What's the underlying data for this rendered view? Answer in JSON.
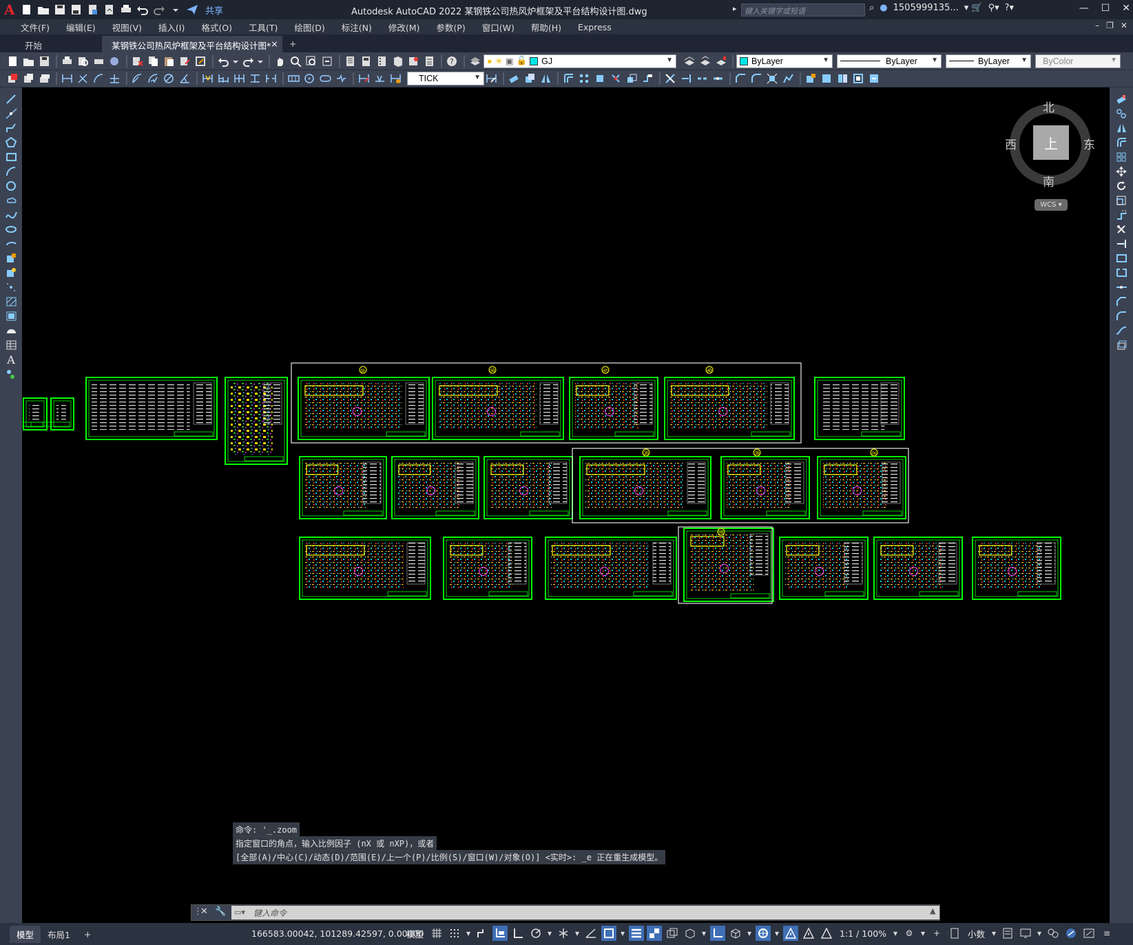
{
  "app": {
    "title": "Autodesk AutoCAD 2022    某钢铁公司热风炉框架及平台结构设计图.dwg",
    "share_label": "共享",
    "search_placeholder": "键入关键字或短语",
    "user": "1505999135...",
    "logo": "A"
  },
  "menus": [
    "文件(F)",
    "编辑(E)",
    "视图(V)",
    "插入(I)",
    "格式(O)",
    "工具(T)",
    "绘图(D)",
    "标注(N)",
    "修改(M)",
    "参数(P)",
    "窗口(W)",
    "帮助(H)",
    "Express"
  ],
  "tabs": {
    "start": "开始",
    "active": "某钢铁公司热风炉框架及平台结构设计图*",
    "close": "×",
    "add": "+"
  },
  "toolbar": {
    "layer": "GJ",
    "color": "ByLayer",
    "linetype": "ByLayer",
    "lineweight": "ByLayer",
    "plotstyle": "ByColor",
    "dimstyle": "TICK",
    "layer_color": "#00e5e5",
    "color_swatch": "#00e5e5"
  },
  "viewcube": {
    "north": "北",
    "south": "南",
    "east": "东",
    "west": "西",
    "top": "上",
    "wcs": "WCS"
  },
  "command": {
    "history": [
      "命令: '_.zoom",
      "指定窗口的角点，输入比例因子 (nX 或 nXP)，或者",
      "[全部(A)/中心(C)/动态(D)/范围(E)/上一个(P)/比例(S)/窗口(W)/对象(O)] <实时>: _e 正在重生成模型。"
    ],
    "placeholder": "键入命令"
  },
  "status": {
    "tab_model": "模型",
    "tab_layout": "布局1",
    "tab_add": "+",
    "coords": "166583.00042, 101289.42597, 0.00000",
    "model_label": "模型",
    "scale": "1:1 / 100%",
    "units": "小数"
  },
  "sheet_markers": {
    "row1": [
      "⑩",
      "㊿",
      "㊼",
      "㊵"
    ],
    "row2": [
      "⑳",
      "㊴",
      "⑭"
    ],
    "row3": [
      "⑱"
    ]
  }
}
